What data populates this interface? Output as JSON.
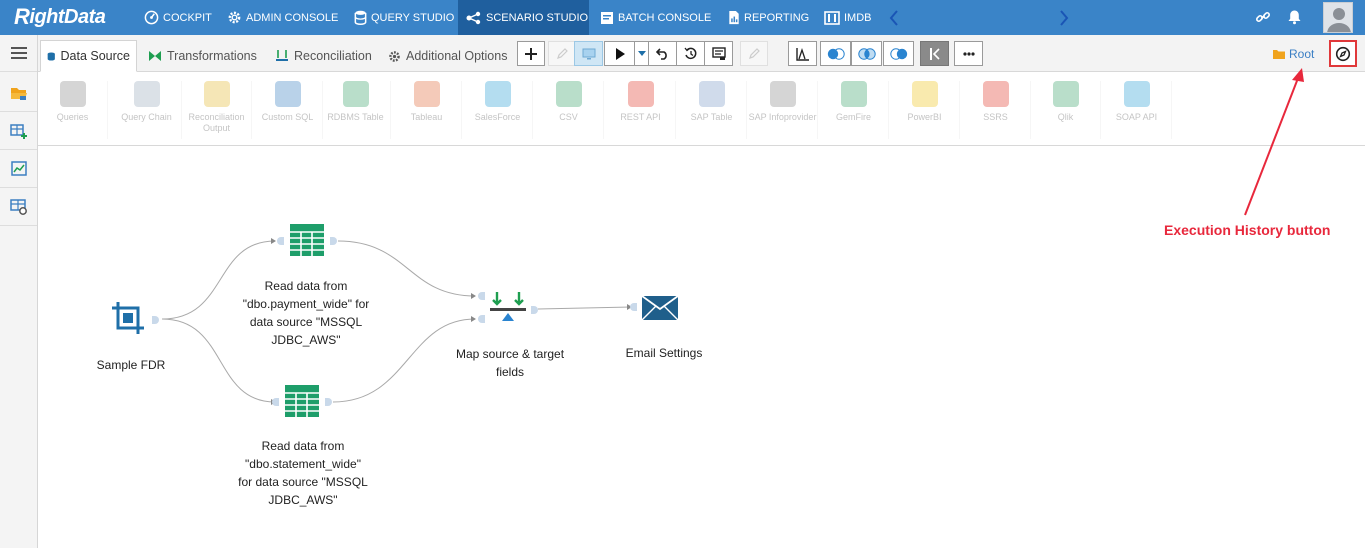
{
  "app": {
    "logo_text_1": "R",
    "logo_text_2": "ightData"
  },
  "nav": {
    "items": [
      {
        "label": "COCKPIT",
        "icon": "cockpit-icon"
      },
      {
        "label": "ADMIN CONSOLE",
        "icon": "gear-icon"
      },
      {
        "label": "QUERY STUDIO",
        "icon": "database-icon"
      },
      {
        "label": "SCENARIO STUDIO",
        "icon": "scenario-icon",
        "active": true
      },
      {
        "label": "BATCH CONSOLE",
        "icon": "batch-icon"
      },
      {
        "label": "REPORTING",
        "icon": "report-icon"
      },
      {
        "label": "IMDB",
        "icon": "imdb-icon"
      }
    ]
  },
  "tabs": [
    {
      "label": "Data Source",
      "active": true
    },
    {
      "label": "Transformations"
    },
    {
      "label": "Reconciliation"
    },
    {
      "label": "Additional Options"
    }
  ],
  "toolbar": {
    "root_label": "Root"
  },
  "palette": [
    {
      "label": "Queries"
    },
    {
      "label": "Query Chain"
    },
    {
      "label": "Reconciliation Output"
    },
    {
      "label": "Custom SQL"
    },
    {
      "label": "RDBMS Table"
    },
    {
      "label": "Tableau"
    },
    {
      "label": "SalesForce"
    },
    {
      "label": "CSV"
    },
    {
      "label": "REST API"
    },
    {
      "label": "SAP Table"
    },
    {
      "label": "SAP Infoprovider"
    },
    {
      "label": "GemFire"
    },
    {
      "label": "PowerBI"
    },
    {
      "label": "SSRS"
    },
    {
      "label": "Qlik"
    },
    {
      "label": "SOAP API"
    }
  ],
  "canvas": {
    "nodes": {
      "sample_fdr": "Sample FDR",
      "read_payment": "Read data from\n\"dbo.payment_wide\" for\ndata source \"MSSQL\nJDBC_AWS\"",
      "read_statement": "Read data from\n\"dbo.statement_wide\"\nfor data source \"MSSQL\nJDBC_AWS\"",
      "map_fields": "Map source & target\nfields",
      "email": "Email Settings"
    }
  },
  "annotation": {
    "label": "Execution History button",
    "color": "#e8283c"
  },
  "colors": {
    "nav_bg": "#3a84c8",
    "nav_active": "#1f5f9e",
    "node_green": "#1e9e6a",
    "node_blue": "#1f6fa8"
  }
}
